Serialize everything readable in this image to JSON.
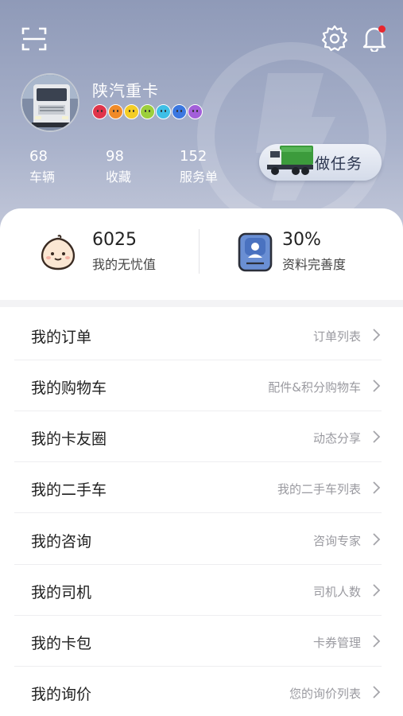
{
  "header": {
    "username": "陕汽重卡",
    "badge_colors": [
      "#e0344a",
      "#f08a28",
      "#f3cd26",
      "#9ccf3c",
      "#3fbfe6",
      "#3b77e0",
      "#a35fd9"
    ],
    "stats": [
      {
        "value": "68",
        "label": "车辆"
      },
      {
        "value": "98",
        "label": "收藏"
      },
      {
        "value": "152",
        "label": "服务单"
      }
    ],
    "task_label": "做任务"
  },
  "card": {
    "points_value": "6025",
    "points_label": "我的无忧值",
    "profile_value": "30%",
    "profile_label": "资料完善度"
  },
  "menu": [
    {
      "title": "我的订单",
      "sub": "订单列表"
    },
    {
      "title": "我的购物车",
      "sub": "配件&积分购物车"
    },
    {
      "title": "我的卡友圈",
      "sub": "动态分享"
    },
    {
      "title": "我的二手车",
      "sub": "我的二手车列表"
    },
    {
      "title": "我的咨询",
      "sub": "咨询专家"
    },
    {
      "title": "我的司机",
      "sub": "司机人数"
    },
    {
      "title": "我的卡包",
      "sub": "卡券管理"
    },
    {
      "title": "我的询价",
      "sub": "您的询价列表"
    }
  ],
  "icons": {
    "scan": "scan-icon",
    "settings": "gear-icon",
    "notifications": "bell-icon",
    "chevron": "chevron-right-icon"
  },
  "colors": {
    "header_top": "#8f9ab8",
    "notification_dot": "#e8262d",
    "task_truck": "#3c9b3c"
  }
}
